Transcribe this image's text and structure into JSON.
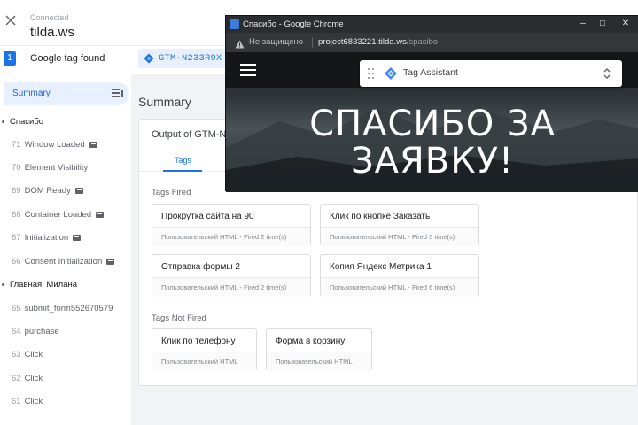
{
  "header": {
    "connection_status": "Connected",
    "domain": "tilda.ws",
    "tag_count": "1",
    "tags_found_label": "Google tag found",
    "container_id": "GTM-N233R9X"
  },
  "sidebar": {
    "summary_label": "Summary",
    "pages": [
      {
        "title": "Спасибо",
        "events": [
          {
            "num": "71",
            "name": "Window Loaded",
            "icon": true
          },
          {
            "num": "70",
            "name": "Element Visibility",
            "icon": false
          },
          {
            "num": "69",
            "name": "DOM Ready",
            "icon": true
          },
          {
            "num": "68",
            "name": "Container Loaded",
            "icon": true
          },
          {
            "num": "67",
            "name": "Initialization",
            "icon": true
          },
          {
            "num": "66",
            "name": "Consent Initialization",
            "icon": true
          }
        ]
      },
      {
        "title": "Главная, Милана",
        "events": [
          {
            "num": "65",
            "name": "submit_form552670579",
            "icon": false
          },
          {
            "num": "64",
            "name": "purchase",
            "icon": false
          },
          {
            "num": "63",
            "name": "Click",
            "icon": false
          },
          {
            "num": "62",
            "name": "Click",
            "icon": false
          },
          {
            "num": "61",
            "name": "Click",
            "icon": false
          }
        ]
      }
    ]
  },
  "main": {
    "title": "Summary",
    "output_title": "Output of GTM-N",
    "tab_label": "Tags",
    "fired_label": "Tags Fired",
    "not_fired_label": "Tags Not Fired",
    "tags_fired": [
      {
        "name": "Прокрутка сайта на 90",
        "meta": "Пользовательский HTML - Fired 2 time(s)"
      },
      {
        "name": "Клик по кнопке Заказать",
        "meta": "Пользовательский HTML - Fired 5 time(s)"
      },
      {
        "name": "Отправка формы 2",
        "meta": "Пользовательский HTML - Fired 2 time(s)"
      },
      {
        "name": "Копия Яндекс Метрика 1",
        "meta": "Пользовательский HTML - Fired 6 time(s)"
      }
    ],
    "tags_not_fired": [
      {
        "name": "Клик по телефону",
        "meta": "Пользовательский HTML"
      },
      {
        "name": "Форма в корзину",
        "meta": "Пользовательский HTML"
      }
    ]
  },
  "chrome": {
    "window_title": "Спасибо - Google Chrome",
    "insecure_label": "Не защищено",
    "url_host": "project6833221.tilda.ws",
    "url_path": "/spasibo",
    "minimize": "–",
    "maximize": "□",
    "close": "✕",
    "headline_line1": "СПАСИБО ЗА",
    "headline_line2": "ЗАЯВКУ!",
    "assistant_label": "Tag Assistant"
  },
  "colors": {
    "accent": "#1a73e8",
    "selected_bg": "#e8f0fe",
    "main_bg": "#f1f3f4"
  },
  "icons": {
    "close": "close-icon",
    "container": "gtm-diamond-icon",
    "summary": "filter-list-icon",
    "event": "event-badge-icon",
    "warning": "warning-icon",
    "menu": "hamburger-menu-icon",
    "drag": "drag-handle-icon",
    "assistant": "tag-assistant-logo-icon",
    "expand": "expand-icon"
  }
}
